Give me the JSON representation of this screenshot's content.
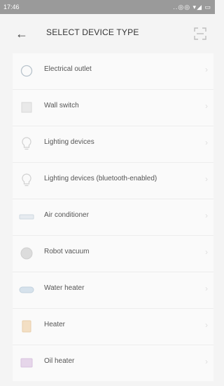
{
  "status_bar": {
    "time": "17:46",
    "icons": "..◎◎ ▾◢ ▭"
  },
  "header": {
    "title": "SELECT DEVICE TYPE",
    "back_icon": "←"
  },
  "devices": [
    {
      "label": "Electrical outlet",
      "icon": "outlet-icon"
    },
    {
      "label": "Wall switch",
      "icon": "wall-switch-icon"
    },
    {
      "label": "Lighting devices",
      "icon": "bulb-icon"
    },
    {
      "label": "Lighting devices (bluetooth-enabled)",
      "icon": "bulb-icon"
    },
    {
      "label": "Air conditioner",
      "icon": "air-conditioner-icon"
    },
    {
      "label": "Robot vacuum",
      "icon": "robot-vacuum-icon"
    },
    {
      "label": "Water heater",
      "icon": "water-heater-icon"
    },
    {
      "label": "Heater",
      "icon": "heater-icon"
    },
    {
      "label": "Oil heater",
      "icon": "oil-heater-icon"
    }
  ],
  "chevron_glyph": "›"
}
